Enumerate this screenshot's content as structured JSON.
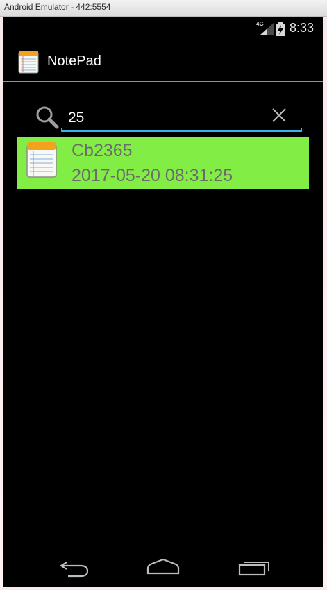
{
  "window": {
    "title": "Android Emulator - 442:5554"
  },
  "status_bar": {
    "network": "4G",
    "time": "8:33"
  },
  "action_bar": {
    "title": "NotePad",
    "divider_color": "#33b5e5"
  },
  "search": {
    "value": "25",
    "underline_color": "#33b5e5"
  },
  "notes": [
    {
      "title": "Cb2365",
      "date": "2017-05-20 08:31:25",
      "background": "#82ee45",
      "icon": "notepad-icon"
    }
  ],
  "nav_bar": {
    "icons": [
      "back-icon",
      "home-icon",
      "recent-apps-icon"
    ]
  }
}
